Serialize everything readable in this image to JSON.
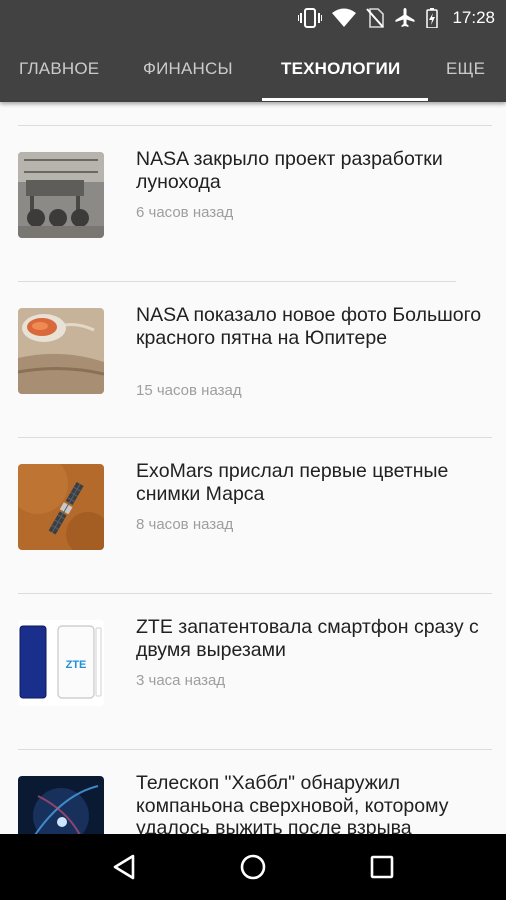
{
  "status_bar": {
    "time": "17:28"
  },
  "tabs": [
    {
      "label": "ГЛАВНОЕ"
    },
    {
      "label": "ФИНАНСЫ"
    },
    {
      "label": "ТЕХНОЛОГИИ",
      "active": true
    },
    {
      "label": "ЕЩЕ"
    }
  ],
  "articles": [
    {
      "title": "NASA закрыло проект разработки лунохода",
      "time": "6 часов назад"
    },
    {
      "title": "NASA показало новое фото Большого красного пятна на Юпитере",
      "time": "15 часов назад"
    },
    {
      "title": "ExoMars прислал первые цветные снимки Марса",
      "time": "8 часов назад"
    },
    {
      "title": "ZTE запатентовала смартфон сразу с двумя вырезами",
      "time": "3 часа назад",
      "thumb_text": "ZTE"
    },
    {
      "title": "Телескоп \"Хаббл\" обнаружил компаньона сверхновой, которому удалось выжить после взрыва"
    }
  ],
  "colors": {
    "app_bar": "#424242",
    "background": "#fafafa",
    "tab_indicator": "#ffffff"
  },
  "nav": {
    "back": "back-icon",
    "home": "home-icon",
    "recents": "recents-icon"
  }
}
